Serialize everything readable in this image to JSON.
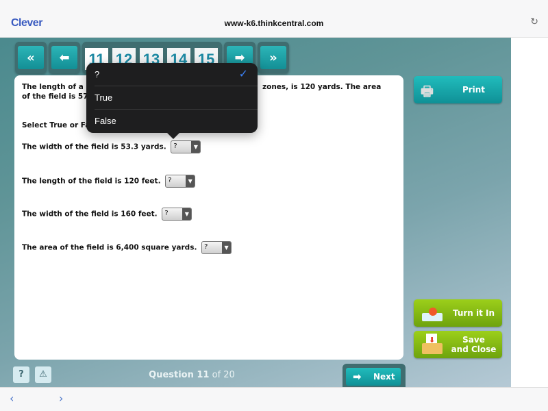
{
  "browser": {
    "brand": "Clever",
    "url": "www-k6.thinkcentral.com",
    "reload_icon": "reload-icon",
    "back_icon": "chevron-left-icon",
    "forward_icon": "chevron-right-icon"
  },
  "nav": {
    "first_icon": "double-left-arrow-icon",
    "prev_icon": "left-arrow-icon",
    "next_icon": "right-arrow-icon",
    "last_icon": "double-right-arrow-icon",
    "pages": [
      "11",
      "12",
      "13",
      "14",
      "15"
    ],
    "current_page": "11"
  },
  "question": {
    "intro_line1_left": "The length of a re",
    "intro_line1_right": "zones, is 120 yards. The area",
    "intro_line2_left": "of the field is 57,",
    "instruction": "Select True or Fal",
    "statements": [
      {
        "text": "The width of the field is 53.3 yards.",
        "value": "?"
      },
      {
        "text": "The length of the field is 120 feet.",
        "value": "?"
      },
      {
        "text": "The width of the field is 160 feet.",
        "value": "?"
      },
      {
        "text": "The area of the field is 6,400 square yards.",
        "value": "?"
      }
    ]
  },
  "popup": {
    "options": [
      "?",
      "True",
      "False"
    ],
    "selected": "?"
  },
  "sidebar": {
    "print": "Print",
    "turn_in": "Turn it In",
    "save_line1": "Save",
    "save_line2": "and Close"
  },
  "footer": {
    "help": "?",
    "alert": "⚠",
    "question_label": "Question 11",
    "question_of": "of 20",
    "next": "Next"
  }
}
